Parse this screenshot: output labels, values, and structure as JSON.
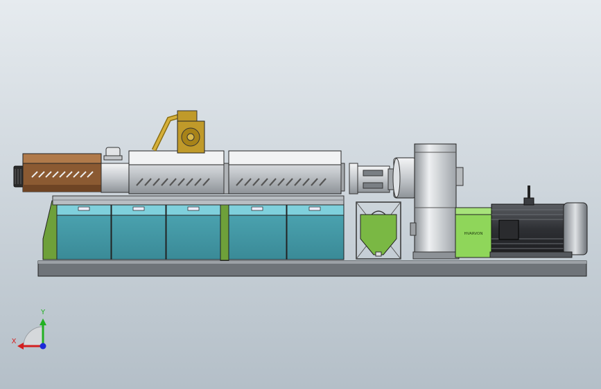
{
  "motor_label": "HVARVON",
  "triad": {
    "x_label": "X",
    "y_label": "Y",
    "colors": {
      "x": "#d31f1f",
      "y": "#22b022",
      "z": "#1c2ad8"
    }
  },
  "colors": {
    "heater": "#8b5a32",
    "heater_band": "#b07a4a",
    "panel": "#4aa0ad",
    "panel_top": "#7fd0dc",
    "frame_green": "#6ea03a",
    "hopper_green": "#7ab844",
    "gearbox_green": "#8fd65a",
    "brass": "#c09a2a",
    "steel": "#c9ccd0",
    "motor": "#3a3c40",
    "base": "#6e7379"
  }
}
